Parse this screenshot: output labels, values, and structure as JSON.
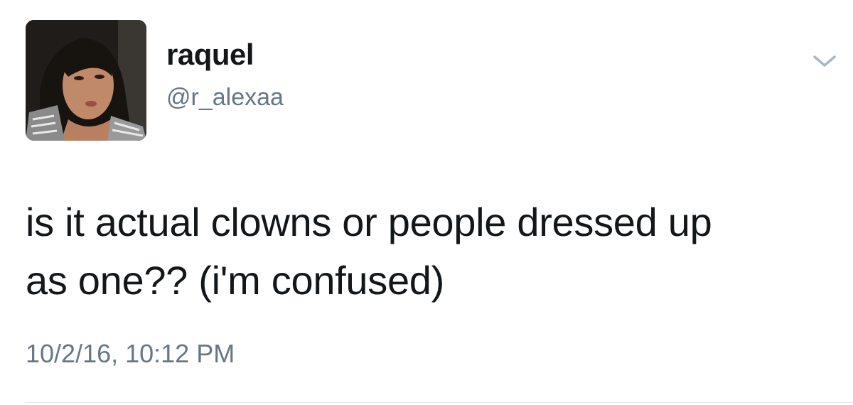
{
  "tweet": {
    "author": {
      "display_name": "raquel",
      "handle": "@r_alexaa",
      "avatar_icon": "profile-photo"
    },
    "text_line1": "is it actual clowns or people dressed up",
    "text_line2": "as one?? (i'm confused)",
    "timestamp": "10/2/16, 10:12 PM",
    "menu_icon": "chevron-down-icon"
  },
  "colors": {
    "text_primary": "#14171a",
    "text_secondary": "#657786",
    "caret": "#aab8c2",
    "divider": "#e1e8ed"
  }
}
